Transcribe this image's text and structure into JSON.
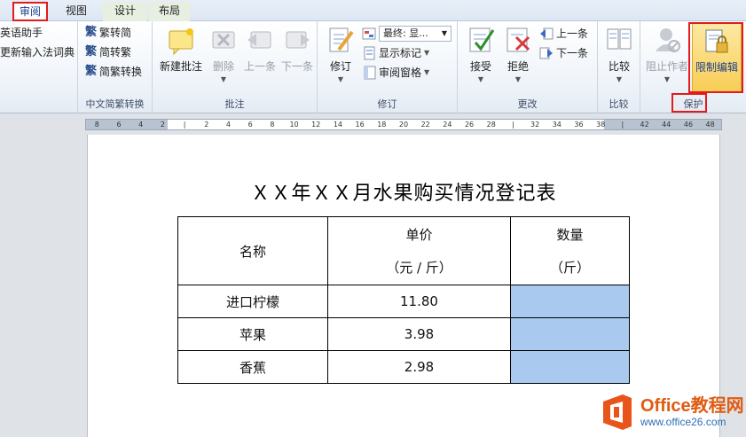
{
  "tabs": [
    {
      "label": "审阅",
      "active": true,
      "highlighted": true
    },
    {
      "label": "视图",
      "active": false
    },
    {
      "label": "设计",
      "active": false
    },
    {
      "label": "布局",
      "active": false
    }
  ],
  "ribbon": {
    "proofing": {
      "items": [
        "英语助手",
        "更新输入法词典"
      ]
    },
    "chinese_conversion": {
      "items": [
        "繁转简",
        "简转繁",
        "简繁转换"
      ],
      "group_label": "中文简繁转换"
    },
    "comments": {
      "new_comment": "新建批注",
      "delete": "删除",
      "previous": "上一条",
      "next": "下一条",
      "group_label": "批注"
    },
    "tracking": {
      "track_changes": "修订",
      "display_dropdown": "最终: 显...",
      "show_markup": "显示标记",
      "reviewing_pane": "审阅窗格",
      "group_label": "修订"
    },
    "changes": {
      "accept": "接受",
      "reject": "拒绝",
      "previous": "上一条",
      "next": "下一条",
      "group_label": "更改"
    },
    "compare": {
      "compare": "比较",
      "group_label": "比较"
    },
    "protect": {
      "block_authors": "阻止作者",
      "restrict_editing": "限制编辑",
      "group_label": "保护"
    }
  },
  "ruler": {
    "labels": [
      "8",
      "6",
      "4",
      "2",
      "",
      "2",
      "4",
      "6",
      "8",
      "10",
      "12",
      "14",
      "16",
      "18",
      "20",
      "22",
      "24",
      "26",
      "28",
      "",
      "32",
      "34",
      "36",
      "38",
      "",
      "42",
      "44",
      "46",
      "48"
    ]
  },
  "document": {
    "title": "ＸＸ年ＸＸ月水果购买情况登记表",
    "table": {
      "headers": [
        {
          "line1": "名称",
          "line2": ""
        },
        {
          "line1": "单价",
          "line2": "（元 / 斤）"
        },
        {
          "line1": "数量",
          "line2": "（斤）"
        }
      ],
      "rows": [
        {
          "name": "进口柠檬",
          "price": "11.80",
          "qty": ""
        },
        {
          "name": "苹果",
          "price": "3.98",
          "qty": ""
        },
        {
          "name": "香蕉",
          "price": "2.98",
          "qty": ""
        }
      ]
    }
  },
  "watermark": {
    "line1": "Office教程网",
    "line2": "www.office26.com"
  },
  "colors": {
    "highlight": "#e21b1b",
    "cell_fill": "#a9c9ef",
    "active_button": "#fbd76b"
  }
}
